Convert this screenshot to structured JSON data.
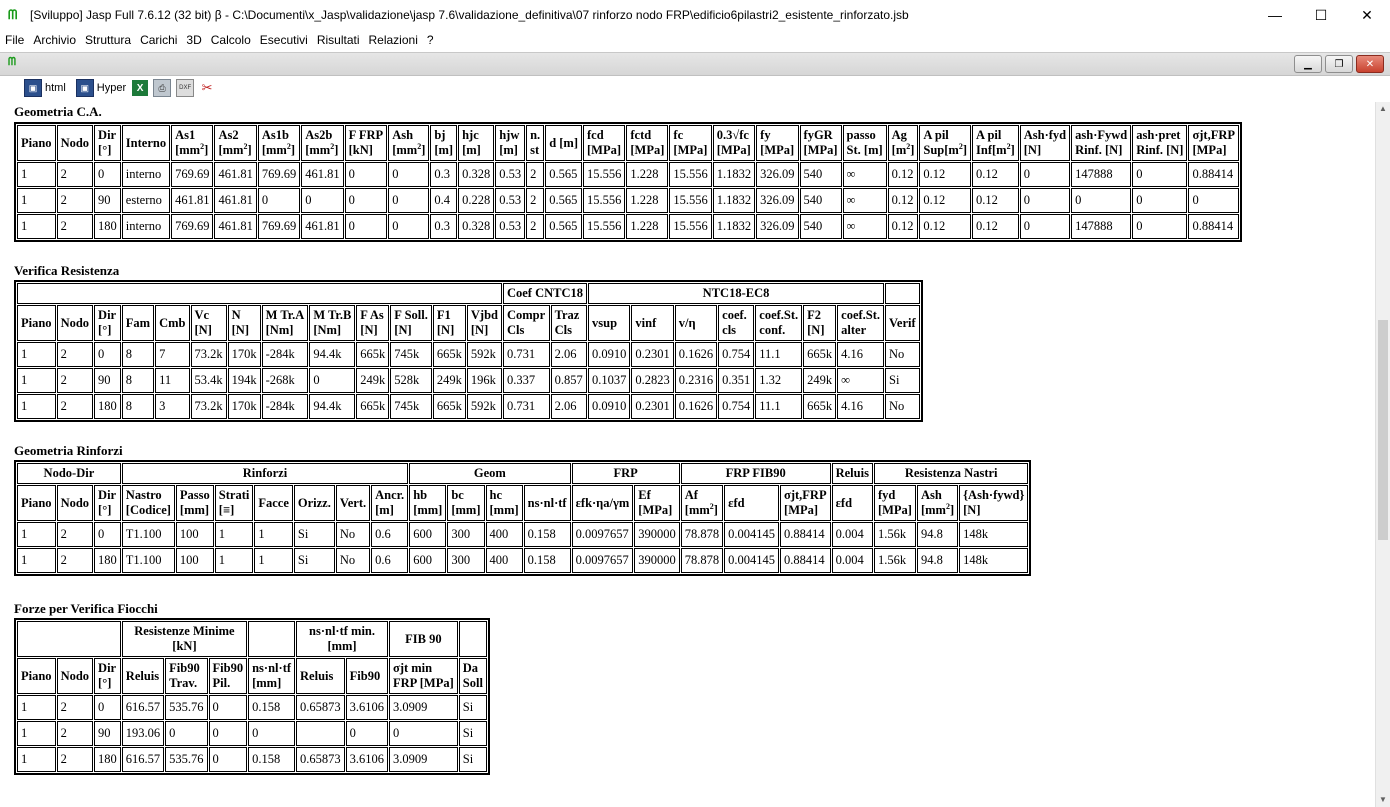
{
  "window": {
    "title": "[Sviluppo] Jasp Full 7.6.12 (32 bit)  β - C:\\Documenti\\x_Jasp\\validazione\\jasp 7.6\\validazione_definitiva\\07 rinforzo nodo FRP\\edificio6pilastri2_esistente_rinforzato.jsb",
    "minimize": "—",
    "maximize": "☐",
    "close": "✕"
  },
  "menu": [
    "File",
    "Archivio",
    "Struttura",
    "Carichi",
    "3D",
    "Calcolo",
    "Esecutivi",
    "Risultati",
    "Relazioni",
    "?"
  ],
  "toolbar": {
    "html_label": "html",
    "hyper_label": "Hyper"
  },
  "icons": {
    "app": "app-logo-icon",
    "disk": "disk-icon",
    "excel": "excel-icon",
    "print": "printer-icon",
    "dxf": "dxf-icon",
    "tools": "tools-icon"
  },
  "colors": {
    "app_logo": "#1a9a1a",
    "excel": "#1d7a3a",
    "mdi_close": "#c8422f"
  },
  "geom_ca": {
    "title": "Geometria C.A.",
    "headers": [
      [
        "Piano"
      ],
      [
        "Nodo"
      ],
      [
        "Dir",
        "[°]"
      ],
      [
        "Interno"
      ],
      [
        "As1",
        "[mm²]"
      ],
      [
        "As2",
        "[mm²]"
      ],
      [
        "As1b",
        "[mm²]"
      ],
      [
        "As2b",
        "[mm²]"
      ],
      [
        "F FRP",
        "[kN]"
      ],
      [
        "Ash",
        "[mm²]"
      ],
      [
        "bj",
        "[m]"
      ],
      [
        "hjc",
        "[m]"
      ],
      [
        "hjw",
        "[m]"
      ],
      [
        "n.",
        "st"
      ],
      [
        "d [m]"
      ],
      [
        "fcd",
        "[MPa]"
      ],
      [
        "fctd",
        "[MPa]"
      ],
      [
        "fc",
        "[MPa]"
      ],
      [
        "0.3√fc",
        "[MPa]"
      ],
      [
        "fy",
        "[MPa]"
      ],
      [
        "fyGR",
        "[MPa]"
      ],
      [
        "passo",
        "St. [m]"
      ],
      [
        "Ag",
        "[m²]"
      ],
      [
        "A pil",
        "Sup[m²]"
      ],
      [
        "A pil",
        "Inf[m²]"
      ],
      [
        "Ash·fyd",
        "[N]"
      ],
      [
        "ash·Fywd",
        "Rinf. [N]"
      ],
      [
        "ash·pret",
        "Rinf. [N]"
      ],
      [
        "σjt,FRP",
        "[MPa]"
      ]
    ],
    "rows": [
      [
        "1",
        "2",
        "0",
        "interno",
        "769.69",
        "461.81",
        "769.69",
        "461.81",
        "0",
        "0",
        "0.3",
        "0.328",
        "0.53",
        "2",
        "0.565",
        "15.556",
        "1.228",
        "15.556",
        "1.1832",
        "326.09",
        "540",
        "∞",
        "0.12",
        "0.12",
        "0.12",
        "0",
        "147888",
        "0",
        "0.88414"
      ],
      [
        "1",
        "2",
        "90",
        "esterno",
        "461.81",
        "461.81",
        "0",
        "0",
        "0",
        "0",
        "0.4",
        "0.228",
        "0.53",
        "2",
        "0.565",
        "15.556",
        "1.228",
        "15.556",
        "1.1832",
        "326.09",
        "540",
        "∞",
        "0.12",
        "0.12",
        "0.12",
        "0",
        "0",
        "0",
        "0"
      ],
      [
        "1",
        "2",
        "180",
        "interno",
        "769.69",
        "461.81",
        "769.69",
        "461.81",
        "0",
        "0",
        "0.3",
        "0.328",
        "0.53",
        "2",
        "0.565",
        "15.556",
        "1.228",
        "15.556",
        "1.1832",
        "326.09",
        "540",
        "∞",
        "0.12",
        "0.12",
        "0.12",
        "0",
        "147888",
        "0",
        "0.88414"
      ]
    ]
  },
  "verifica": {
    "title": "Verifica Resistenza",
    "group_coef": "Coef CNTC18",
    "group_ntc": "NTC18-EC8",
    "headers": [
      [
        "Piano"
      ],
      [
        "Nodo"
      ],
      [
        "Dir",
        "[°]"
      ],
      [
        "Fam"
      ],
      [
        "Cmb"
      ],
      [
        "Vc",
        "[N]"
      ],
      [
        "N",
        "[N]"
      ],
      [
        "M Tr.A",
        "[Nm]"
      ],
      [
        "M Tr.B",
        "[Nm]"
      ],
      [
        "F As",
        "[N]"
      ],
      [
        "F Soll.",
        "[N]"
      ],
      [
        "F1",
        "[N]"
      ],
      [
        "Vjbd",
        "[N]"
      ],
      [
        "Compr",
        "Cls"
      ],
      [
        "Traz",
        "Cls"
      ],
      [
        "vsup"
      ],
      [
        "vinf"
      ],
      [
        "v/η"
      ],
      [
        "coef.",
        "cls"
      ],
      [
        "coef.St.",
        "conf."
      ],
      [
        "F2",
        "[N]"
      ],
      [
        "coef.St.",
        "alter"
      ],
      [
        "Verif"
      ]
    ],
    "rows": [
      [
        "1",
        "2",
        "0",
        "8",
        "7",
        "73.2k",
        "170k",
        "-284k",
        "94.4k",
        "665k",
        "745k",
        "665k",
        "592k",
        "0.731",
        "2.06",
        "0.0910",
        "0.2301",
        "0.1626",
        "0.754",
        "11.1",
        "665k",
        "4.16",
        "No"
      ],
      [
        "1",
        "2",
        "90",
        "8",
        "11",
        "53.4k",
        "194k",
        "-268k",
        "0",
        "249k",
        "528k",
        "249k",
        "196k",
        "0.337",
        "0.857",
        "0.1037",
        "0.2823",
        "0.2316",
        "0.351",
        "1.32",
        "249k",
        "∞",
        "Si"
      ],
      [
        "1",
        "2",
        "180",
        "8",
        "3",
        "73.2k",
        "170k",
        "-284k",
        "94.4k",
        "665k",
        "745k",
        "665k",
        "592k",
        "0.731",
        "2.06",
        "0.0910",
        "0.2301",
        "0.1626",
        "0.754",
        "11.1",
        "665k",
        "4.16",
        "No"
      ]
    ]
  },
  "rinforzi": {
    "title": "Geometria Rinforzi",
    "groups": [
      "Nodo-Dir",
      "Rinforzi",
      "Geom",
      "FRP",
      "FRP FIB90",
      "Reluis",
      "Resistenza Nastri"
    ],
    "headers": [
      [
        "Piano"
      ],
      [
        "Nodo"
      ],
      [
        "Dir",
        "[°]"
      ],
      [
        "Nastro",
        "[Codice]"
      ],
      [
        "Passo",
        "[mm]"
      ],
      [
        "Strati",
        "[≡]"
      ],
      [
        "Facce"
      ],
      [
        "Orizz."
      ],
      [
        "Vert."
      ],
      [
        "Ancr.",
        "[m]"
      ],
      [
        "hb",
        "[mm]"
      ],
      [
        "bc",
        "[mm]"
      ],
      [
        "hc",
        "[mm]"
      ],
      [
        "ns·nl·tf"
      ],
      [
        "εfk·ηa/γm"
      ],
      [
        "Ef",
        "[MPa]"
      ],
      [
        "Af",
        "[mm²]"
      ],
      [
        "εfd"
      ],
      [
        "σjt,FRP",
        "[MPa]"
      ],
      [
        "εfd"
      ],
      [
        "fyd",
        "[MPa]"
      ],
      [
        "Ash",
        "[mm²]"
      ],
      [
        "{Ash·fywd}",
        "[N]"
      ]
    ],
    "rows": [
      [
        "1",
        "2",
        "0",
        "T1.100",
        "100",
        "1",
        "1",
        "Si",
        "No",
        "0.6",
        "600",
        "300",
        "400",
        "0.158",
        "0.0097657",
        "390000",
        "78.878",
        "0.004145",
        "0.88414",
        "0.004",
        "1.56k",
        "94.8",
        "148k"
      ],
      [
        "1",
        "2",
        "180",
        "T1.100",
        "100",
        "1",
        "1",
        "Si",
        "No",
        "0.6",
        "600",
        "300",
        "400",
        "0.158",
        "0.0097657",
        "390000",
        "78.878",
        "0.004145",
        "0.88414",
        "0.004",
        "1.56k",
        "94.8",
        "148k"
      ]
    ]
  },
  "fiocchi": {
    "title": "Forze per Verifica Fiocchi",
    "groups": [
      [
        "Resistenze Minime",
        "[kN]"
      ],
      [
        "ns·nl·tf min.",
        "[mm]"
      ],
      [
        "FIB 90"
      ]
    ],
    "headers": [
      [
        "Piano"
      ],
      [
        "Nodo"
      ],
      [
        "Dir",
        "[°]"
      ],
      [
        "Reluis"
      ],
      [
        "Fib90",
        "Trav."
      ],
      [
        "Fib90",
        "Pil."
      ],
      [
        "ns·nl·tf",
        "[mm]"
      ],
      [
        "Reluis"
      ],
      [
        "Fib90"
      ],
      [
        "σjt min",
        "FRP [MPa]"
      ],
      [
        "Da",
        "Soll"
      ]
    ],
    "rows": [
      [
        "1",
        "2",
        "0",
        "616.57",
        "535.76",
        "0",
        "0.158",
        "0.65873",
        "3.6106",
        "3.0909",
        "Si"
      ],
      [
        "1",
        "2",
        "90",
        "193.06",
        "0",
        "0",
        "0",
        "",
        "0",
        "0",
        "Si"
      ],
      [
        "1",
        "2",
        "180",
        "616.57",
        "535.76",
        "0",
        "0.158",
        "0.65873",
        "3.6106",
        "3.0909",
        "Si"
      ]
    ]
  }
}
